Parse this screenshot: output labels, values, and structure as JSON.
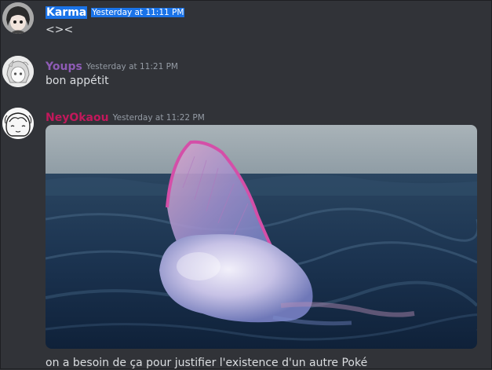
{
  "messages": [
    {
      "username": "Karma",
      "timestamp": "Yesterday at 11:11 PM",
      "content": "<><",
      "color": "#ffffff"
    },
    {
      "username": "Youps",
      "timestamp": "Yesterday at 11:21 PM",
      "content": "bon appétit",
      "color": "#8e5bb5"
    },
    {
      "username": "NeyOkaou",
      "timestamp": "Yesterday at 11:22 PM",
      "content": "on a besoin de ça pour justifier l'existence d'un autre Poké",
      "color": "#c2185b"
    }
  ],
  "selection_color": "#1a73e8"
}
